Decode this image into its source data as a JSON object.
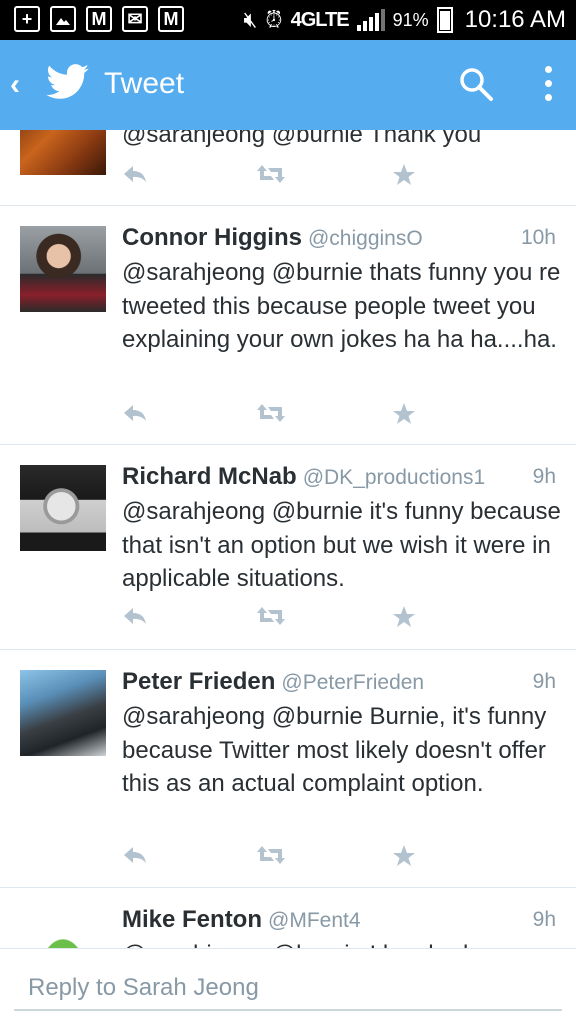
{
  "status_bar": {
    "network": "4GLTE",
    "battery": "91%",
    "time": "10:16 AM"
  },
  "app_bar": {
    "title": "Tweet"
  },
  "tweets": [
    {
      "name": "",
      "handle": "",
      "time": "",
      "text": "@sarahjeong @burnie Thank you"
    },
    {
      "name": "Connor Higgins",
      "handle": "@chigginsO",
      "time": "10h",
      "text": "@sarahjeong @burnie thats funny you re tweeted this because people tweet you explaining your own jokes ha ha ha....ha."
    },
    {
      "name": "Richard McNab",
      "handle": "@DK_productions1",
      "time": "9h",
      "text": "@sarahjeong @burnie  it's funny because that isn't an option but we wish it were in applicable situations."
    },
    {
      "name": "Peter Frieden",
      "handle": "@PeterFrieden",
      "time": "9h",
      "text": "@sarahjeong @burnie Burnie, it's funny because Twitter most likely doesn't offer this as an actual complaint option."
    },
    {
      "name": "Mike Fenton",
      "handle": "@MFent4",
      "time": "9h",
      "text": "@sarahjeong @burnie I laughed so"
    }
  ],
  "reply": {
    "placeholder": "Reply to Sarah Jeong"
  },
  "colors": {
    "brand": "#55acee",
    "action_icon": "#b3c2cf",
    "handle": "#8899a6"
  },
  "icons": [
    "plus-icon",
    "image-icon",
    "gmail-icon",
    "mail-icon",
    "mute-icon",
    "alarm-icon",
    "signal-icon",
    "battery-icon",
    "back-chevron-icon",
    "twitter-bird-icon",
    "search-icon",
    "more-vert-icon",
    "reply-icon",
    "retweet-icon",
    "favorite-star-icon"
  ]
}
